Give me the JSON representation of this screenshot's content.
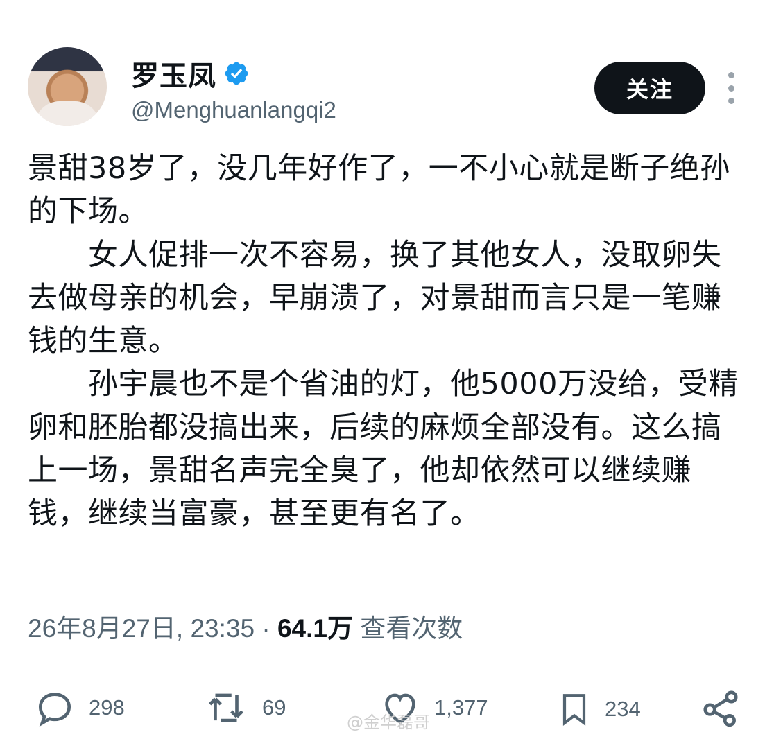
{
  "author": {
    "name": "罗玉凤",
    "handle": "@Menghuanlangqi2",
    "verified_icon": "verified-badge-icon",
    "verified_color": "#1d9bf0"
  },
  "follow_label": "关注",
  "post": {
    "text": "景甜38岁了，没几年好作了，一不小心就是断子绝孙的下场。\n　　女人促排一次不容易，换了其他女人，没取卵失去做母亲的机会，早崩溃了，对景甜而言只是一笔赚钱的生意。\n　　孙宇晨也不是个省油的灯，他5000万没给，受精卵和胚胎都没搞出来，后续的麻烦全部没有。这么搞上一场，景甜名声完全臭了，他却依然可以继续赚钱，继续当富豪，甚至更有名了。",
    "datetime": "26年8月27日, 23:35",
    "separator": "·",
    "views": "64.1万",
    "views_label": "查看次数"
  },
  "actions": {
    "replies": "298",
    "retweets": "69",
    "likes": "1,377",
    "bookmarks": "234"
  },
  "watermark": "@金华磊哥"
}
